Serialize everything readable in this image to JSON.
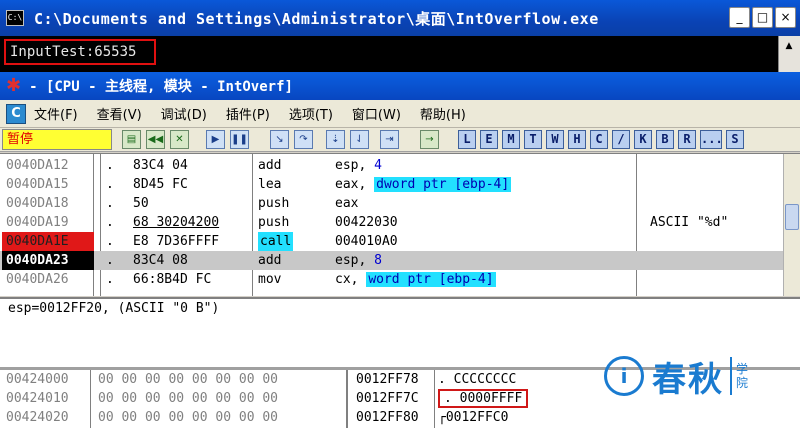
{
  "console": {
    "title_icon": "C:\\",
    "title": "C:\\Documents and Settings\\Administrator\\桌面\\IntOverflow.exe",
    "output_line": "InputTest:65535",
    "buttons": {
      "minimize": "_",
      "maximize": "□",
      "close": "×"
    },
    "scroll_up": "▲"
  },
  "olly": {
    "title": "- [CPU -  主线程, 模块 - IntOverf]",
    "menu_icon": "C",
    "menu": [
      "文件(F)",
      "查看(V)",
      "调试(D)",
      "插件(P)",
      "选项(T)",
      "窗口(W)",
      "帮助(H)"
    ],
    "status": "暂停",
    "toolbar_letters": [
      "L",
      "E",
      "M",
      "T",
      "W",
      "H",
      "C",
      "/",
      "K",
      "B",
      "R",
      "...",
      "S"
    ]
  },
  "disasm": {
    "rows": [
      {
        "addr": "0040DA12",
        "mark": ".",
        "hex": "83C4 04",
        "mnemonic": "add",
        "op1": "esp, ",
        "op_hl": "",
        "op_imm": "4",
        "comment": ""
      },
      {
        "addr": "0040DA15",
        "mark": ".",
        "hex": "8D45 FC",
        "mnemonic": "lea",
        "op1": "eax, ",
        "op_hl": "dword ptr [ebp-4]",
        "op_imm": "",
        "comment": ""
      },
      {
        "addr": "0040DA18",
        "mark": ".",
        "hex": "50",
        "mnemonic": "push",
        "op1": "eax",
        "op_hl": "",
        "op_imm": "",
        "comment": ""
      },
      {
        "addr": "0040DA19",
        "mark": ".",
        "hex": "68 30204200",
        "mnemonic": "push",
        "op1": "00422030",
        "op_hl": "",
        "op_imm": "",
        "comment": "ASCII \"%d\""
      },
      {
        "addr": "0040DA1E",
        "mark": ".",
        "hex": "E8 7D36FFFF",
        "mnemonic": "call",
        "op1": "004010A0",
        "op_hl": "",
        "op_imm": "",
        "comment": ""
      },
      {
        "addr": "0040DA23",
        "mark": ".",
        "hex": "83C4 08",
        "mnemonic": "add",
        "op1": "esp, ",
        "op_hl": "",
        "op_imm": "8",
        "comment": ""
      },
      {
        "addr": "0040DA26",
        "mark": ".",
        "hex": "66:8B4D FC",
        "mnemonic": "mov",
        "op1": "cx, ",
        "op_hl": "word ptr [ebp-4]",
        "op_imm": "",
        "comment": ""
      }
    ]
  },
  "info": {
    "text": "esp=0012FF20, (ASCII \"0 B\")"
  },
  "dump": {
    "rows": [
      {
        "addr": "00424000",
        "hex": "00 00 00 00 00 00 00 00"
      },
      {
        "addr": "00424010",
        "hex": "00 00 00 00 00 00 00 00"
      },
      {
        "addr": "00424020",
        "hex": "00 00 00 00 00 00 00 00"
      }
    ]
  },
  "stack": {
    "rows": [
      {
        "addr": "0012FF78",
        "value": ". CCCCCCCC"
      },
      {
        "addr": "0012FF7C",
        "value": ". 0000FFFF"
      },
      {
        "addr": "0012FF80",
        "value": "┌0012FFC0"
      }
    ]
  },
  "watermark": {
    "logo": "i",
    "name": "春秋",
    "suffix": "学院"
  },
  "colors": {
    "eip_bg": "#000000",
    "breakpoint_bg": "#e01818",
    "highlight": "#22e0ff",
    "annotation_red": "#d01818",
    "title_blue": "#0a43b5"
  }
}
